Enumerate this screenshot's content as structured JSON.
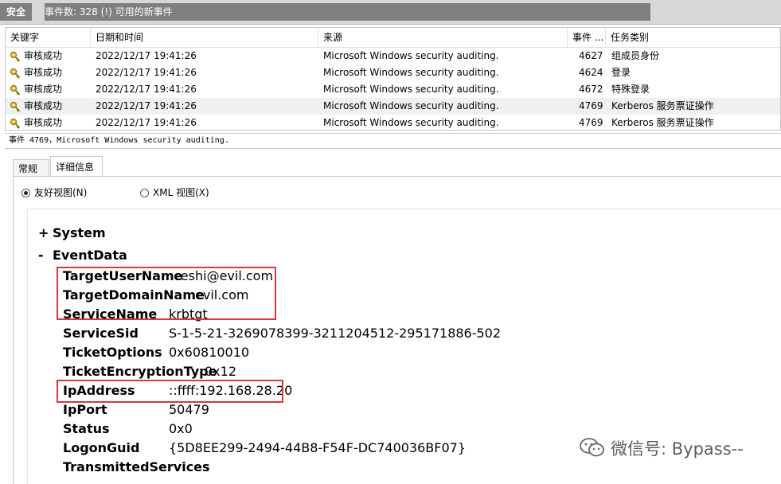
{
  "titlebar": {
    "title": "安全",
    "count": "事件数: 328 (!) 可用的新事件"
  },
  "list": {
    "columns": [
      "关键字",
      "日期和时间",
      "来源",
      "事件 ...",
      "任务类别"
    ],
    "rows": [
      {
        "keyword": "审核成功",
        "datetime": "2022/12/17 19:41:26",
        "source": "Microsoft Windows security auditing.",
        "id": "4627",
        "category": "组成员身份"
      },
      {
        "keyword": "审核成功",
        "datetime": "2022/12/17 19:41:26",
        "source": "Microsoft Windows security auditing.",
        "id": "4624",
        "category": "登录"
      },
      {
        "keyword": "审核成功",
        "datetime": "2022/12/17 19:41:26",
        "source": "Microsoft Windows security auditing.",
        "id": "4672",
        "category": "特殊登录"
      },
      {
        "keyword": "审核成功",
        "datetime": "2022/12/17 19:41:26",
        "source": "Microsoft Windows security auditing.",
        "id": "4769",
        "category": "Kerberos 服务票证操作"
      },
      {
        "keyword": "审核成功",
        "datetime": "2022/12/17 19:41:26",
        "source": "Microsoft Windows security auditing.",
        "id": "4769",
        "category": "Kerberos 服务票证操作"
      }
    ]
  },
  "infobar": "事件 4769，Microsoft Windows security auditing.",
  "tabs": {
    "general": "常规",
    "details": "详细信息"
  },
  "radio": {
    "friendly": "友好视图(N)",
    "xml": "XML 视图(X)"
  },
  "tree": {
    "system": "System",
    "system_sign": "+",
    "eventdata": "EventData",
    "eventdata_sign": "-"
  },
  "fields": [
    {
      "name": "TargetUserName",
      "value": "ceshi@evil.com"
    },
    {
      "name": "TargetDomainName",
      "value": "evil.com"
    },
    {
      "name": "ServiceName",
      "value": "krbtgt"
    },
    {
      "name": "ServiceSid",
      "value": "S-1-5-21-3269078399-3211204512-295171886-502"
    },
    {
      "name": "TicketOptions",
      "value": "0x60810010"
    },
    {
      "name": "TicketEncryptionType",
      "value": "0x12"
    },
    {
      "name": "IpAddress",
      "value": "::ffff:192.168.28.20"
    },
    {
      "name": "IpPort",
      "value": "50479"
    },
    {
      "name": "Status",
      "value": "0x0"
    },
    {
      "name": "LogonGuid",
      "value": "{5D8EE299-2494-44B8-F54F-DC740036BF07}"
    },
    {
      "name": "TransmittedServices",
      "value": "-"
    }
  ],
  "watermark": "微信号: Bypass--",
  "colors": {
    "highlight_box": "#d9363e",
    "selected_row": "#f0f0f0"
  }
}
